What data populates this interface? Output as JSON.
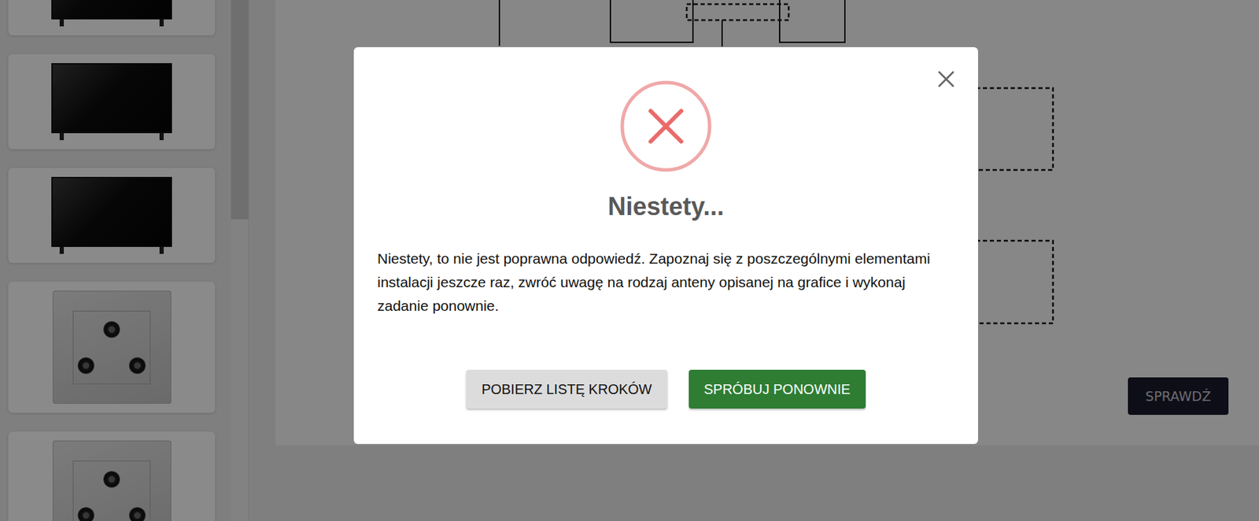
{
  "sidebar": {
    "items": [
      {
        "kind": "tv"
      },
      {
        "kind": "tv"
      },
      {
        "kind": "tv"
      },
      {
        "kind": "socket"
      },
      {
        "kind": "socket"
      }
    ]
  },
  "canvas": {
    "check_button": "SPRAWDŹ"
  },
  "dialog": {
    "title": "Niestety...",
    "message": "Niestety, to nie jest poprawna odpowiedź. Zapoznaj się z poszczególnymi elementami instalacji jeszcze raz, zwróć uwagę na rodzaj anteny opisanej na grafice i wykonaj zadanie ponownie.",
    "buttons": [
      {
        "label": "POBIERZ LISTĘ KROKÓW",
        "kind": "secondary"
      },
      {
        "label": "SPRÓBUJ PONOWNIE",
        "kind": "primary"
      }
    ]
  }
}
